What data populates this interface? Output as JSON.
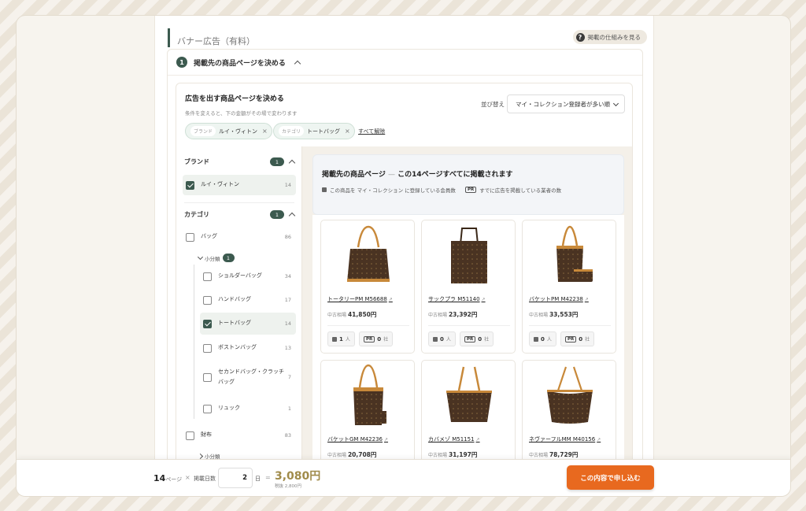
{
  "panel": {
    "title": "バナー広告（有料）",
    "help_label": "掲載の仕組みを見る",
    "step_number": "1",
    "step_title": "掲載先の商品ページを決める"
  },
  "selector": {
    "title": "広告を出す商品ページを決める",
    "subtitle": "条件を変えると、下の金額がその場で変わります",
    "sort_label": "並び替え",
    "sort_value": "マイ・コレクション登録者が多い順",
    "chips": [
      {
        "key": "ブランド",
        "value": "ルイ・ヴィトン"
      },
      {
        "key": "カテゴリ",
        "value": "トートバッグ"
      }
    ],
    "clear_all": "すべて解除"
  },
  "filters": {
    "brand": {
      "heading": "ブランド",
      "badge": "1",
      "items": [
        {
          "label": "ルイ・ヴィトン",
          "count": "14",
          "checked": true
        }
      ]
    },
    "category": {
      "heading": "カテゴリ",
      "badge": "1",
      "bag": {
        "label": "バッグ",
        "count": "86"
      },
      "sub_toggle": "小分類",
      "sub_badge": "1",
      "sub_items": [
        {
          "label": "ショルダーバッグ",
          "count": "34"
        },
        {
          "label": "ハンドバッグ",
          "count": "17"
        },
        {
          "label": "トートバッグ",
          "count": "14"
        },
        {
          "label": "ボストンバッグ",
          "count": "13"
        },
        {
          "label": "セカンドバッグ・クラッチバッグ",
          "count": "7"
        },
        {
          "label": "リュック",
          "count": "1"
        }
      ],
      "wallet": {
        "label": "財布",
        "count": "83"
      },
      "wallet_sub_toggle": "小分類"
    }
  },
  "results": {
    "title_prefix": "掲載先の商品ページ",
    "title_dash": "—",
    "title_main": "この14ページすべてに掲載されます",
    "legend_members": "この商品を マイ・コレクション に登録している会員数",
    "legend_pr_tag": "PR",
    "legend_pr": "すでに広告を掲載している業者の数",
    "price_label": "中古相場",
    "members_unit": "人",
    "pr_unit": "社",
    "products": [
      {
        "name": "トータリーPM M56688",
        "price": "41,850円",
        "members": "1",
        "pr": "0",
        "variant": "tote"
      },
      {
        "name": "サックプラ M51140",
        "price": "23,392円",
        "members": "0",
        "pr": "0",
        "variant": "sac"
      },
      {
        "name": "バケットPM M42238",
        "price": "33,553円",
        "members": "0",
        "pr": "0",
        "variant": "bucket"
      },
      {
        "name": "バケットGM M42236",
        "price": "20,708円",
        "members": "",
        "pr": "",
        "variant": "bucketgm"
      },
      {
        "name": "カバメゾ M51151",
        "price": "31,197円",
        "members": "",
        "pr": "",
        "variant": "cabas"
      },
      {
        "name": "ネヴァーフルMM M40156",
        "price": "78,729円",
        "members": "",
        "pr": "",
        "variant": "never"
      }
    ]
  },
  "footer": {
    "pages": "14",
    "pages_unit": "ページ",
    "times": "×",
    "days_label": "掲載日数",
    "days_value": "2",
    "days_unit": "日",
    "equals": "=",
    "total": "3,080円",
    "total_sub": "税抜 2,800円",
    "submit": "この内容で申し込む"
  },
  "colors": {
    "accent": "#3c5a4f",
    "submit": "#e8691f",
    "total": "#a08b4a"
  }
}
